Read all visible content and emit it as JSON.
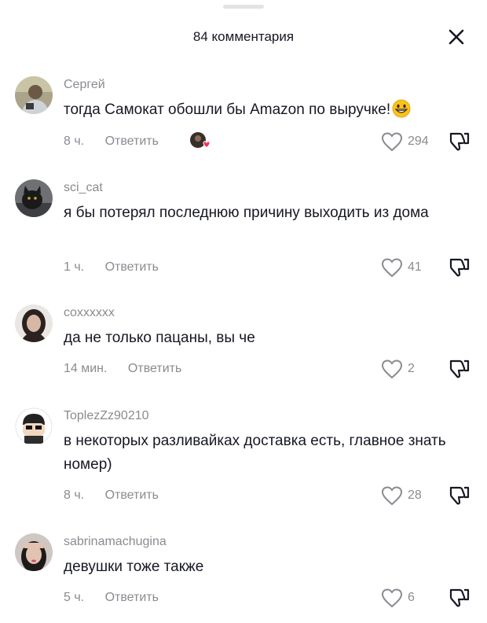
{
  "header": {
    "title": "84 комментария"
  },
  "reply_label": "Ответить",
  "icons": {
    "close": "close-icon",
    "like": "heart-icon",
    "dislike": "thumbs-down-icon"
  },
  "colors": {
    "text": "#161823",
    "muted": "#8a8b91",
    "heart_badge": "#fe2c55"
  },
  "comments": [
    {
      "username": "Сергей",
      "text": "тогда Самокат обошли бы Amazon по выручке!",
      "time": "8 ч.",
      "likes": "294",
      "creator_liked": true,
      "emoji": "grinning-face-emoji"
    },
    {
      "username": "sci_cat",
      "text": "я бы потерял последнюю причину выходить из дома",
      "time": "1 ч.",
      "likes": "41"
    },
    {
      "username": "coxxxxxx",
      "text": "да не только пацаны, вы че",
      "time": "14 мин.",
      "likes": "2"
    },
    {
      "username": "ToplezZz90210",
      "text": "в некоторых разливайках доставка есть, главное знать номер)",
      "time": "8 ч.",
      "likes": "28"
    },
    {
      "username": "sabrinamachugina",
      "text": "девушки тоже также",
      "time": "5 ч.",
      "likes": "6"
    }
  ]
}
